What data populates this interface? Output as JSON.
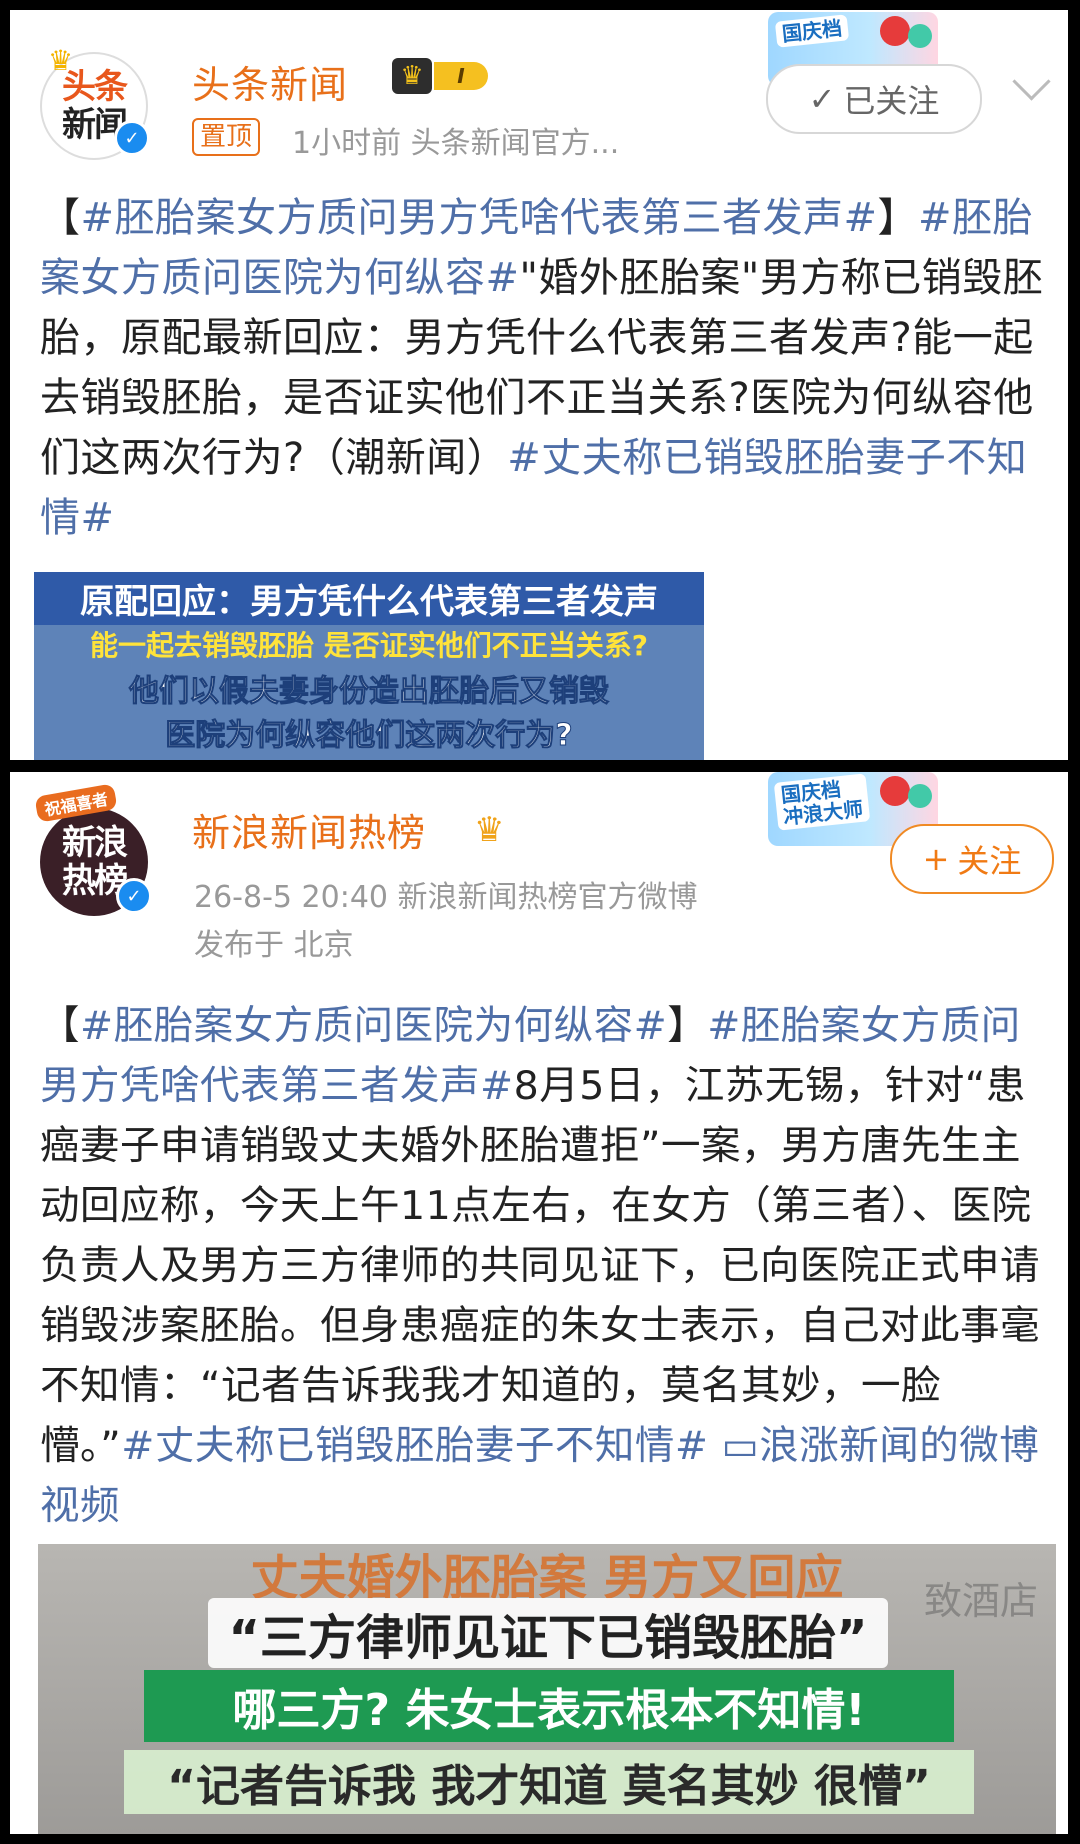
{
  "post1": {
    "avatar": {
      "line1": "头条",
      "line2": "新闻"
    },
    "account_name": "头条新闻",
    "level_badge": "I",
    "pin_tag": "置顶",
    "meta": "1小时前   头条新闻官方...",
    "banner_text": "国庆档",
    "follow_button": {
      "icon": "✓",
      "label": "已关注"
    },
    "text_segments": [
      {
        "text": "【",
        "tag": false
      },
      {
        "text": "#胚胎案女方质问男方凭啥代表第三者发声#",
        "tag": true
      },
      {
        "text": "】",
        "tag": false
      },
      {
        "text": "#胚胎案女方质问医院为何纵容#",
        "tag": true
      },
      {
        "text": "\"婚外胚胎案\"男方称已销毁胚胎，原配最新回应：男方凭什么代表第三者发声?能一起去销毁胚胎，是否证实他们不正当关系?医院为何纵容他们这两次行为?（潮新闻）",
        "tag": false
      },
      {
        "text": "#丈夫称已销毁胚胎妻子不知情#",
        "tag": true
      }
    ],
    "media_caption": {
      "line1": "原配回应：男方凭什么代表第三者发声",
      "line2": "能一起去销毁胚胎 是否证实他们不正当关系?",
      "line3": "他们以假夫妻身份造出胚胎后又销毁",
      "line4": "医院为何纵容他们这两次行为?"
    }
  },
  "post2": {
    "avatar": {
      "line1": "新浪",
      "line2": "热榜",
      "ribbon": "祝福喜者"
    },
    "account_name": "新浪新闻热榜",
    "meta_line1": "26-8-5 20:40   新浪新闻热榜官方微博",
    "meta_line2": "发布于 北京",
    "banner_text": "国庆档\n冲浪大师",
    "follow_button": {
      "icon": "+",
      "label": "关注"
    },
    "text_segments": [
      {
        "text": "【",
        "tag": false
      },
      {
        "text": "#胚胎案女方质问医院为何纵容#",
        "tag": true
      },
      {
        "text": "】",
        "tag": false
      },
      {
        "text": "#胚胎案女方质问男方凭啥代表第三者发声#",
        "tag": true
      },
      {
        "text": "8月5日，江苏无锡，针对“患癌妻子申请销毁丈夫婚外胚胎遭拒”一案，男方唐先生主动回应称，今天上午11点左右，在女方（第三者）、医院负责人及男方三方律师的共同见证下，已向医院正式申请销毁涉案胚胎。但身患癌症的朱女士表示，自己对此事毫不知情：“记者告诉我我才知道的，莫名其妙，一脸懵。”",
        "tag": false
      },
      {
        "text": "#丈夫称已销毁胚胎妻子不知情#",
        "tag": true
      },
      {
        "text": " ▭浪涨新闻的微博视频",
        "tag": true
      }
    ],
    "media_caption": {
      "line1": "丈夫婚外胚胎案 男方又回应",
      "line2": "“三方律师见证下已销毁胚胎”",
      "line3": "哪三方? 朱女士表示根本不知情!",
      "line4": "“记者告诉我 我才知道 莫名其妙 很懵”",
      "sign": "致酒店"
    }
  },
  "colors": {
    "account_orange": "#e8701a",
    "hashtag_blue": "#4f6fa8",
    "verified_blue": "#1a8cf0"
  }
}
